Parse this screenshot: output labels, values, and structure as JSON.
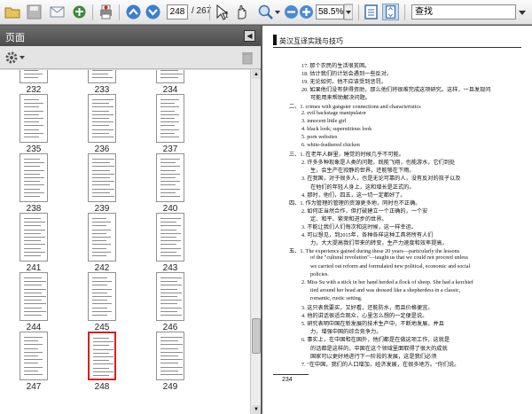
{
  "toolbar": {
    "current_page": "248",
    "page_total": "/ 267",
    "zoom_value": "58.5%",
    "find_placeholder": "查找"
  },
  "panel": {
    "title": "页面"
  },
  "thumbnails": [
    {
      "label": "232"
    },
    {
      "label": "233"
    },
    {
      "label": "234"
    },
    {
      "label": "235"
    },
    {
      "label": "236"
    },
    {
      "label": "237"
    },
    {
      "label": "238"
    },
    {
      "label": "239"
    },
    {
      "label": "240"
    },
    {
      "label": "241"
    },
    {
      "label": "242"
    },
    {
      "label": "243"
    },
    {
      "label": "244"
    },
    {
      "label": "245"
    },
    {
      "label": "246"
    },
    {
      "label": "247"
    },
    {
      "label": "248"
    },
    {
      "label": "249"
    }
  ],
  "doc": {
    "header": "英汉互译实践与技巧",
    "lines": [
      "17. 那个农民的生活很贫困。",
      "18. 估计我们的计划会遇到一些反对。",
      "19. 无论如何，他不应该受到惩罚。",
      "20. 如果他们没有获得资助，那么他们将很难完成这项研究。这样，一旦发现问",
      "可能用来帮助解决问题。",
      "二、1. crimes with gangster connections and characteristics",
      "2. evil backstage manipulator",
      "3. innocent little girl",
      "4. black look; superstitious look",
      "5. porn websites",
      "6. white-feathered chicken",
      "三、1. 在老年人群里，睡觉的时候几乎不可能。",
      "2. 许多多种现象是人类的问题，既能飞翔，也能游水，它们到处",
      "生，会生产在寂静的世界，还能够在下雨。",
      "3. 在我国，对于很多人，也是无论可靠的人，没有反对的孩子以及",
      "在他们的年轻人身上，这和增长是正式的。",
      "4. 那时，他们，四五，这一切一定都好了。",
      "四、1. 作为管理的管理的资源更多地，同时也不正确。",
      "2. 如何正当然合作，但打破建立一个正确的，一个安",
      "定、和平、繁荣和进步的世界。",
      "3. 不能让我们人们每次和这时候，这一样幸运。",
      "4. 可以想见，到2015年，各种各样这种工具将所有人们",
      "力，大大提高我们带来的转变，生产力速度和效率提高。",
      "五、1. The experience gained during these 20 years—particularly the lessons",
      "of the \"cultural revolution\"—taught us that we could not proceed unless",
      "we carried out reform and formulated new political, economic and social",
      "policies.",
      "2. Miss Su with a stick in her hand herded a flock of sheep. She had a kerchief",
      "tied around her head and was dressed like a shepherdess in a classic,",
      "romantic, rustic setting.",
      "3. 这只表我要买，又好看，还能防水，而且价格便宜。",
      "4. 他的讲话很适合观众，心里怎么想的一定便是说。",
      "5. 研究表明中国在新发展的技术生产中，不断地发展，并且",
      "力，增强中国的综合竞争力。",
      "6. 事实上，在中国和在国外，他们都是在做这项工作，这就是",
      "的话都是这样的，中国在这个领域里面取得了很大的成就",
      "国家可以更好地进行下一阶段的发展，这是我们必须",
      "7. \"在中国，我们的人口增加，经济发展，在很多地方。\"你们说。"
    ],
    "page_number": "234"
  }
}
